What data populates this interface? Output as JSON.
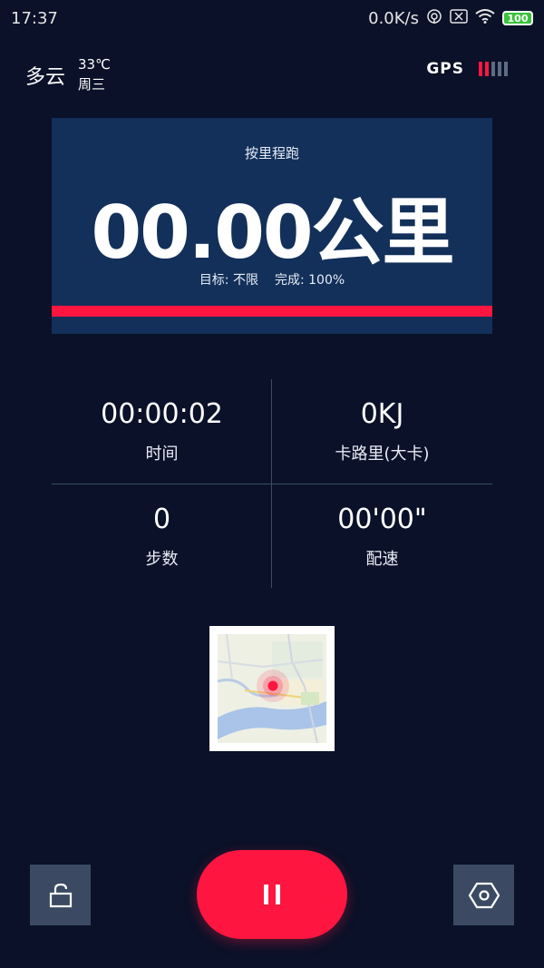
{
  "status_bar": {
    "time": "17:37",
    "network_speed": "0.0K/s",
    "battery": "100"
  },
  "weather": {
    "description": "多云",
    "temperature": "33℃",
    "weekday": "周三"
  },
  "gps": {
    "label": "GPS",
    "signal_level": 2,
    "signal_max": 5,
    "active_color": "#ff1640",
    "inactive_color": "#5c6c84"
  },
  "distance_card": {
    "mode": "按里程跑",
    "distance": "00.00公里",
    "target_text": "目标: 不限",
    "completion_text": "完成: 100%",
    "progress_fraction": 1.0
  },
  "stats": {
    "time": {
      "value": "00:00:02",
      "label": "时间"
    },
    "calories": {
      "value": "0KJ",
      "label": "卡路里(大卡)"
    },
    "steps": {
      "value": "0",
      "label": "步数"
    },
    "pace": {
      "value": "00'00\"",
      "label": "配速"
    }
  },
  "colors": {
    "background": "#0a1128",
    "card": "#13305a",
    "accent": "#ff1640",
    "button_gray": "#3b4a62"
  },
  "icons": {
    "lock": "lock-icon",
    "pause": "pause-icon",
    "settings": "settings-icon",
    "location": "location-pin-icon"
  }
}
